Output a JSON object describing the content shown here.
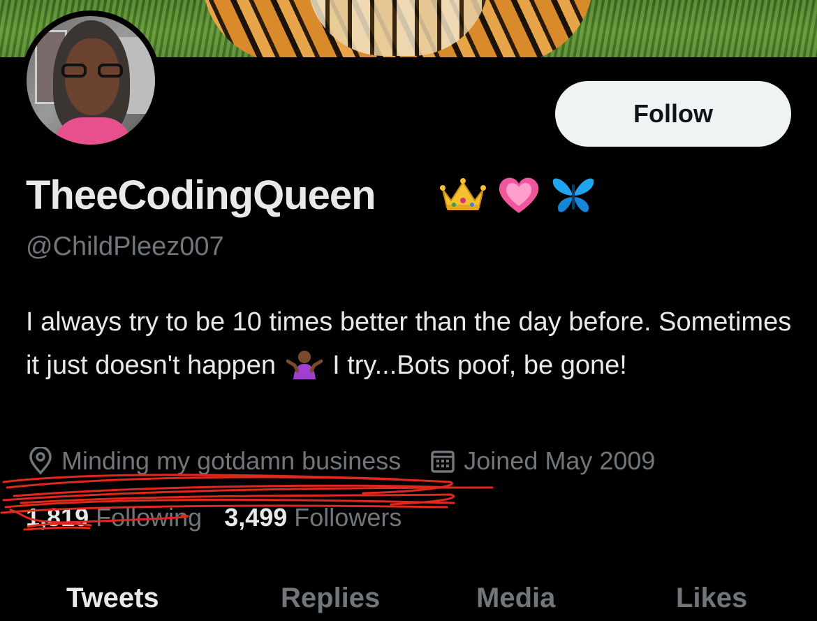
{
  "profile": {
    "display_name": "TheeCodingQueen",
    "name_emojis": [
      "crown-emoji",
      "heart-emoji",
      "butterfly-emoji"
    ],
    "handle": "@ChildPleez007",
    "bio_part1": "I always try to be 10 times better than the day before. Sometimes it just doesn't happen ",
    "bio_part2": " I try...Bots poof, be gone!",
    "location": "Minding my gotdamn business",
    "joined": "Joined May 2009"
  },
  "stats": {
    "following_count": "1,819",
    "following_label": "Following",
    "followers_count": "3,499",
    "followers_label": "Followers"
  },
  "actions": {
    "follow_label": "Follow"
  },
  "tabs": [
    {
      "label": "Tweets",
      "active": true
    },
    {
      "label": "Replies",
      "active": false
    },
    {
      "label": "Media",
      "active": false
    },
    {
      "label": "Likes",
      "active": false
    }
  ],
  "colors": {
    "background": "#000000",
    "primary_text": "#e7e9ea",
    "secondary_text": "#71767b",
    "follow_button_bg": "#eff3f4",
    "annotation_red": "#e0281e"
  }
}
